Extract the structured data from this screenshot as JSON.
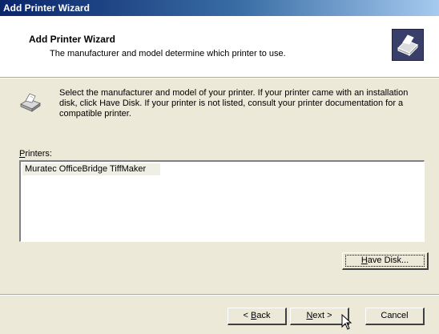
{
  "window": {
    "title": "Add Printer Wizard"
  },
  "header": {
    "title": "Add Printer Wizard",
    "subtitle": "The manufacturer and model determine which printer to use.",
    "icon": "printer-icon"
  },
  "intro": {
    "icon": "printer-icon",
    "text": "Select the manufacturer and model of your printer. If your printer came with an installation disk, click Have Disk. If your printer is not listed, consult your printer documentation for a compatible printer."
  },
  "printers": {
    "label_first": "P",
    "label_rest": "rinters:",
    "items": [
      "Muratec OfficeBridge TiffMaker"
    ]
  },
  "buttons": {
    "have_disk_ul": "H",
    "have_disk_rest": "ave Disk...",
    "back_prefix": "< ",
    "back_ul": "B",
    "back_rest": "ack",
    "next_ul": "N",
    "next_rest": "ext >",
    "cancel": "Cancel"
  },
  "colors": {
    "titlebar_start": "#0a246a",
    "titlebar_end": "#a6caf0",
    "dialog_bg": "#ece9d8"
  }
}
